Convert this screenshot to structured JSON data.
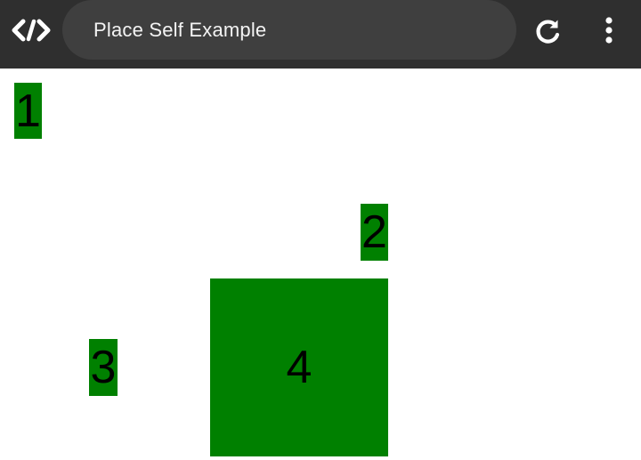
{
  "window": {
    "title": "Place Self Example",
    "background": "#2f2f2f"
  },
  "toolbar": {
    "app_icon": "code-brackets-icon",
    "reload_icon": "reload-icon",
    "more_icon": "more-vertical-icon"
  },
  "content": {
    "items": [
      {
        "label": "1",
        "color": "#008000"
      },
      {
        "label": "2",
        "color": "#008000"
      },
      {
        "label": "3",
        "color": "#008000"
      },
      {
        "label": "4",
        "color": "#008000"
      }
    ]
  }
}
